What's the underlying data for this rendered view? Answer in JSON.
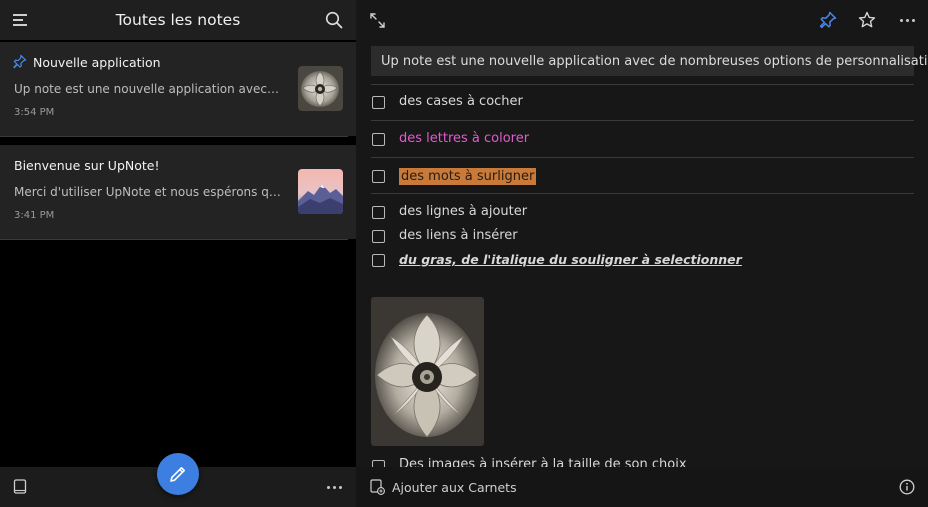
{
  "left_panel": {
    "title": "Toutes les notes",
    "notes": [
      {
        "title": "Nouvelle application",
        "preview": "Up note est une nouvelle application avec de n...",
        "time": "3:54 PM",
        "pinned": true,
        "thumbnail": "poppy-flower-image"
      },
      {
        "title": "Bienvenue sur UpNote!",
        "preview": "Merci d'utiliser UpNote et nous espérons que v...",
        "time": "3:41 PM",
        "pinned": false,
        "thumbnail": "mountain-sunset-image"
      }
    ]
  },
  "editor": {
    "highlight_line": "Up note est une nouvelle application avec de nombreuses options de personnalisation",
    "checklist": [
      {
        "label": "des cases à cocher",
        "style": "normal",
        "checked": false
      },
      {
        "label": "des lettres à colorer",
        "style": "pink",
        "checked": false
      },
      {
        "label": "des mots à surligner",
        "style": "highlight",
        "checked": false
      },
      {
        "label": "des lignes à ajouter",
        "style": "normal",
        "checked": false
      },
      {
        "label": "des liens à insérer",
        "style": "normal",
        "checked": false
      },
      {
        "label": "du gras, de l'italique du souligner à selectionner",
        "style": "bold-italic-underline",
        "checked": false
      }
    ],
    "cut_off_item": "Des images à insérer à la taille de son choix",
    "image": "poppy-flower-image"
  },
  "footer": {
    "add_to_notebooks": "Ajouter aux Carnets"
  },
  "colors": {
    "accent": "#3d7fe0",
    "pink_text": "#e25bd1",
    "highlight": "#c77a3a"
  }
}
